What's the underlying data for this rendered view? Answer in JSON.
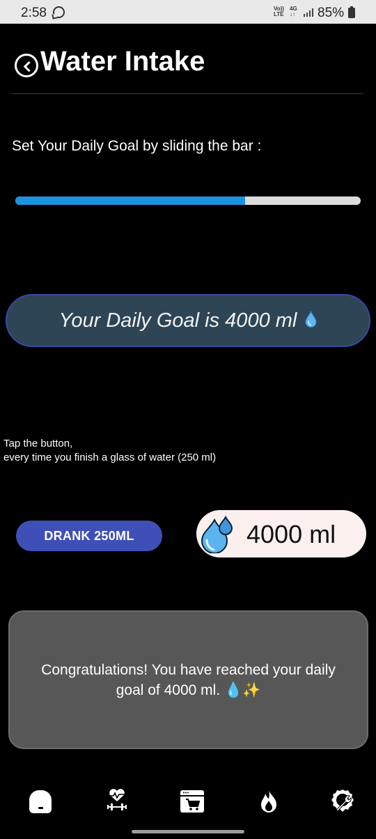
{
  "status_bar": {
    "time": "2:58",
    "volte_label": "Vo)) LTE",
    "network_label": "4G",
    "battery": "85%"
  },
  "header": {
    "title": "Water Intake"
  },
  "goal_section": {
    "instruction": "Set Your Daily Goal by sliding the bar :",
    "slider_fill_fraction": 0.665,
    "goal_text": "Your Daily Goal is 4000 ml"
  },
  "tracker": {
    "tap_line1": "Tap the button,",
    "tap_line2": "every time you finish a glass of water (250 ml)",
    "drank_button": "DRANK 250ML",
    "counter_value": "4000 ml"
  },
  "congrats": {
    "message": "Congratulations! You have reached your daily goal of 4000 ml. 💧✨"
  },
  "bottom_nav": {
    "items": [
      "home-icon",
      "fitness-icon",
      "shop-icon",
      "fire-icon",
      "tools-icon"
    ]
  },
  "colors": {
    "slider_fill": "#1c93e0",
    "goal_pill_bg": "#2d4554",
    "button_bg": "#3f4fb8",
    "counter_bg": "#fcf0ef",
    "congrats_bg": "#575757"
  }
}
